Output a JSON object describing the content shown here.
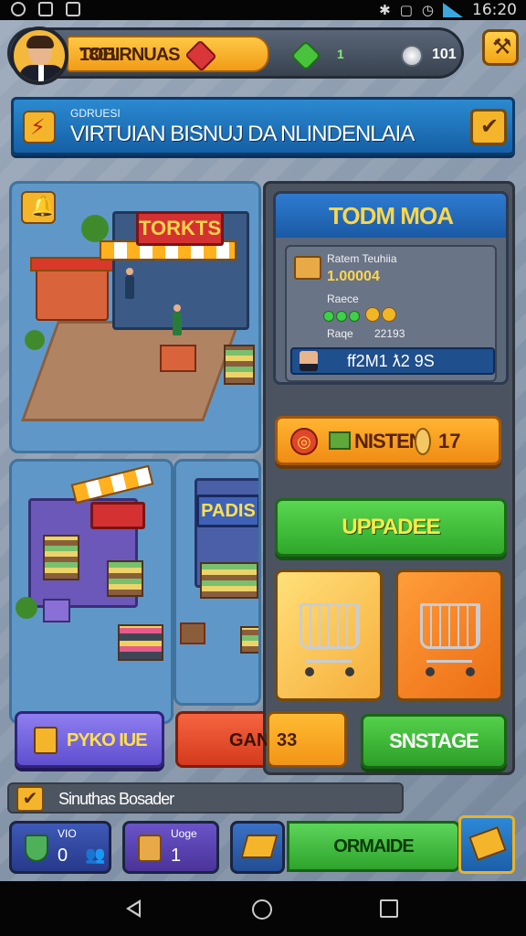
{
  "status_bar": {
    "time": "16:20"
  },
  "top_bar": {
    "shop_name": "TOBIRNUAS",
    "cash": "1801",
    "gems": "1",
    "coins": "101",
    "settings_icon": "hammer-icon"
  },
  "banner": {
    "subtitle": "GDRUESI",
    "title": "VIRTUIAN BISNUJ DA  NLINDENLAIA"
  },
  "scene": {
    "main_sign": "TORKTS",
    "left_sign": "",
    "right_sign": "PADIS"
  },
  "info_card": {
    "title": "TODM MOA",
    "stat1_label": "Ratem Teuhiia",
    "stat1_value": "1.00004",
    "stat2_label": "Raece",
    "stat3_label": "Raqe",
    "stat3_value": "22193",
    "name_value": "ff2M1 ƛ2 9S"
  },
  "orange_bar": {
    "text": "NISTEN",
    "num": "17"
  },
  "upgrade": {
    "label": "UPPADEE"
  },
  "actions": {
    "purple_label": "PYKO IUE",
    "red_label": "GAN",
    "orange_label": "33",
    "green_label": "SNSTAGE"
  },
  "bottom": {
    "strip_text": "Sinuthas Bosader",
    "hb1_label": "VIO",
    "hb1_value": "0",
    "hb2_label": "Uoge",
    "hb2_value": "1",
    "green_long": "ORMAIDE"
  },
  "colors": {
    "accent": "#f5b52a",
    "primary_blue": "#2b8ad1",
    "green": "#2fa82a"
  }
}
